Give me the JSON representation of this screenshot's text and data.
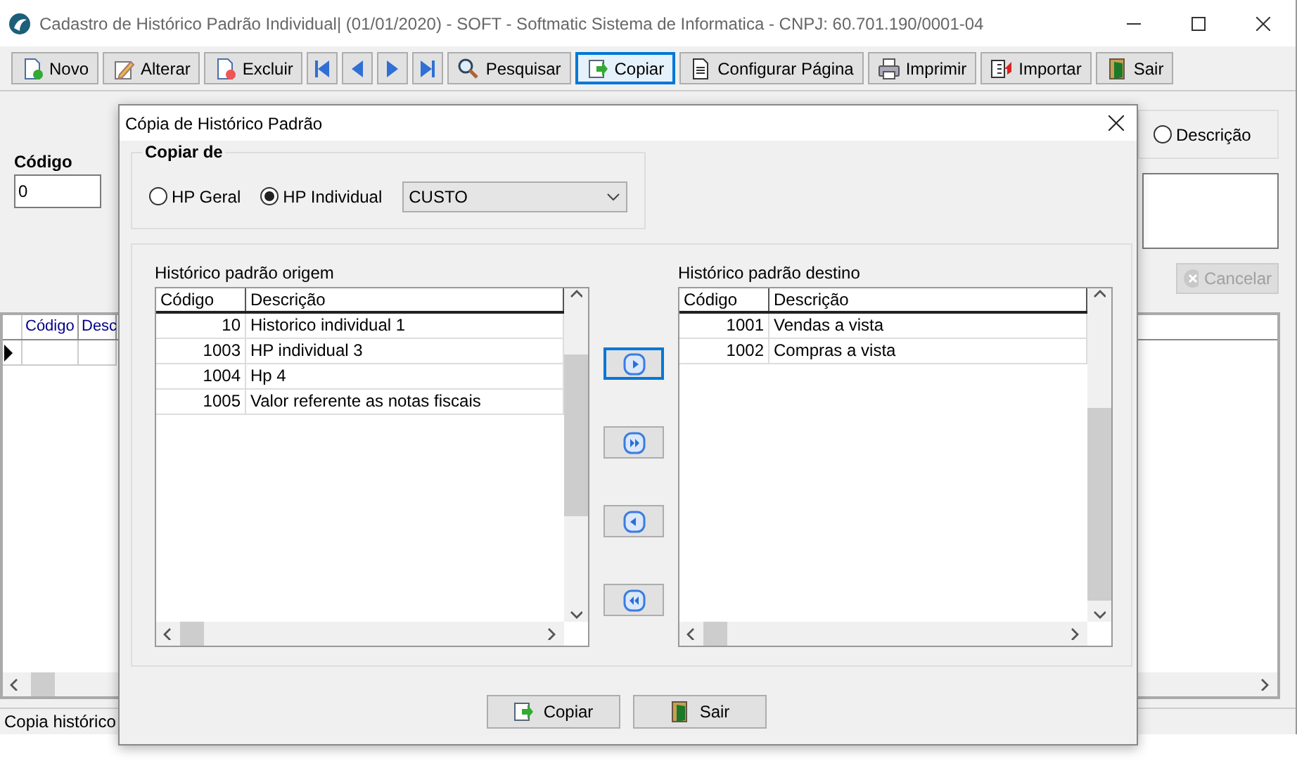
{
  "window": {
    "title": "Cadastro de Histórico Padrão Individual| (01/01/2020) - SOFT - Softmatic Sistema de Informatica  - CNPJ: 60.701.190/0001-04"
  },
  "toolbar": [
    {
      "kind": "new",
      "label": "Novo",
      "focused": false
    },
    {
      "kind": "edit",
      "label": "Alterar",
      "focused": false
    },
    {
      "kind": "delete",
      "label": "Excluir",
      "focused": false
    },
    {
      "kind": "first",
      "focused": false
    },
    {
      "kind": "prev",
      "focused": false
    },
    {
      "kind": "next",
      "focused": false
    },
    {
      "kind": "last",
      "focused": false
    },
    {
      "kind": "search",
      "label": "Pesquisar",
      "focused": false
    },
    {
      "kind": "copy",
      "label": "Copiar",
      "focused": true
    },
    {
      "kind": "page",
      "label": "Configurar Página",
      "focused": false
    },
    {
      "kind": "print",
      "label": "Imprimir",
      "focused": false
    },
    {
      "kind": "import",
      "label": "Importar",
      "focused": false
    },
    {
      "kind": "exit",
      "label": "Sair",
      "focused": false
    }
  ],
  "form": {
    "code_label": "Código",
    "code_value": "0",
    "search_option": {
      "label": "Descrição",
      "selected": false
    },
    "cancel_button": {
      "label": "Cancelar",
      "disabled": true
    }
  },
  "grid": {
    "columns": [
      "Código",
      "Desc"
    ]
  },
  "status_bar": "Copia histórico",
  "dialog": {
    "title": "Cópia de Histórico Padrão",
    "source_group": {
      "title": "Copiar de",
      "options": [
        {
          "label": "HP Geral",
          "selected": false
        },
        {
          "label": "HP Individual",
          "selected": true
        }
      ],
      "select": {
        "value": "CUSTO"
      }
    },
    "lists": [
      {
        "label": "Histórico padrão origem",
        "columns": [
          "Código",
          "Descrição"
        ],
        "rows": [
          [
            "10",
            "Historico individual 1"
          ],
          [
            "1003",
            "HP individual 3"
          ],
          [
            "1004",
            "Hp 4"
          ],
          [
            "1005",
            "Valor referente as notas fiscais"
          ]
        ]
      },
      {
        "label": "Histórico padrão destino",
        "columns": [
          "Código",
          "Descrição"
        ],
        "rows": [
          [
            "1001",
            "Vendas a vista"
          ],
          [
            "1002",
            "Compras a vista"
          ]
        ]
      }
    ],
    "transfer_buttons": [
      {
        "kind": "add",
        "focused": true
      },
      {
        "kind": "add-all",
        "focused": false
      },
      {
        "kind": "remove",
        "focused": false
      },
      {
        "kind": "remove-all",
        "focused": false
      }
    ],
    "buttons": [
      {
        "kind": "copy",
        "label": "Copiar"
      },
      {
        "kind": "exit",
        "label": "Sair"
      }
    ]
  }
}
